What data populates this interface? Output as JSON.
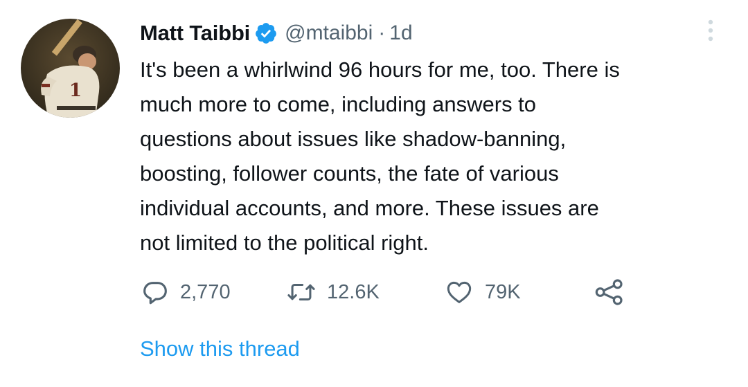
{
  "tweet": {
    "author": {
      "name": "Matt Taibbi",
      "handle": "@mtaibbi",
      "verified": true,
      "avatar_icon": "baseball-player-avatar"
    },
    "separator": "·",
    "timestamp": "1d",
    "text_lines": [
      "It's been a whirlwind 96 hours for me, too. There is",
      "much more to come, including answers to",
      "questions about issues like shadow-banning,",
      "boosting, follower counts, the fate of various",
      "individual accounts, and more. These issues are",
      "not limited to the political right."
    ],
    "actions": {
      "reply": {
        "icon": "reply-icon",
        "count": "2,770"
      },
      "retweet": {
        "icon": "retweet-icon",
        "count": "12.6K"
      },
      "like": {
        "icon": "heart-icon",
        "count": "79K"
      },
      "share": {
        "icon": "share-icon"
      }
    },
    "show_thread_label": "Show this thread"
  },
  "colors": {
    "text": "#0f1419",
    "secondary": "#536471",
    "accent": "#1d9bf0",
    "verified": "#1d9bf0"
  }
}
